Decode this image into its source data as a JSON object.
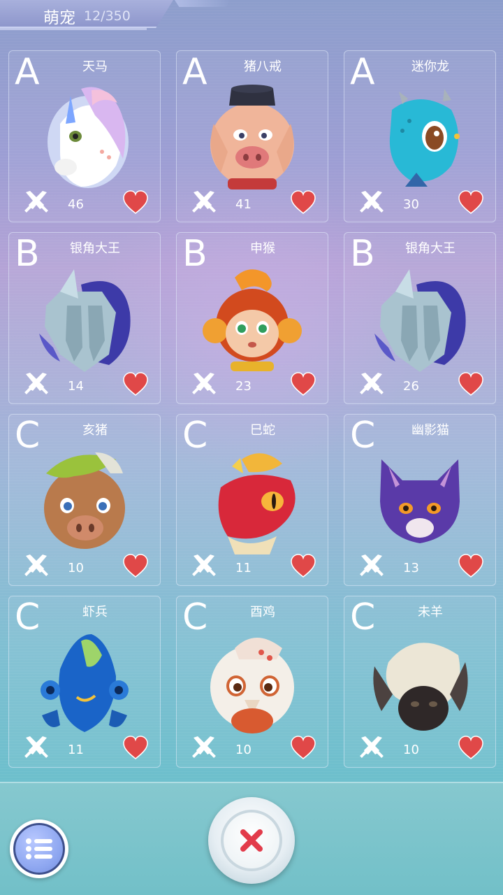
{
  "header": {
    "title": "萌宠",
    "count": "12/350"
  },
  "pets": [
    {
      "grade": "A",
      "name": "天马",
      "power": "46",
      "art": "unicorn"
    },
    {
      "grade": "A",
      "name": "猪八戒",
      "power": "41",
      "art": "pig-monk"
    },
    {
      "grade": "A",
      "name": "迷你龙",
      "power": "30",
      "art": "mini-dragon"
    },
    {
      "grade": "B",
      "name": "银角大王",
      "power": "14",
      "art": "silver-horn-king"
    },
    {
      "grade": "B",
      "name": "申猴",
      "power": "23",
      "art": "monkey"
    },
    {
      "grade": "B",
      "name": "银角大王",
      "power": "26",
      "art": "silver-horn-king"
    },
    {
      "grade": "C",
      "name": "亥猪",
      "power": "10",
      "art": "pig"
    },
    {
      "grade": "C",
      "name": "巳蛇",
      "power": "11",
      "art": "snake"
    },
    {
      "grade": "C",
      "name": "幽影猫",
      "power": "13",
      "art": "shadow-cat"
    },
    {
      "grade": "C",
      "name": "虾兵",
      "power": "11",
      "art": "shrimp-soldier"
    },
    {
      "grade": "C",
      "name": "酉鸡",
      "power": "10",
      "art": "rooster"
    },
    {
      "grade": "C",
      "name": "未羊",
      "power": "10",
      "art": "sheep"
    }
  ],
  "icons": {
    "attack": "crossed-swords-icon",
    "favorite": "heart-icon",
    "menu": "list-icon",
    "close": "close-icon"
  },
  "colors": {
    "heart": "#e04848",
    "close_x": "#e23b4a",
    "menu_blue": "#8da6f0"
  }
}
